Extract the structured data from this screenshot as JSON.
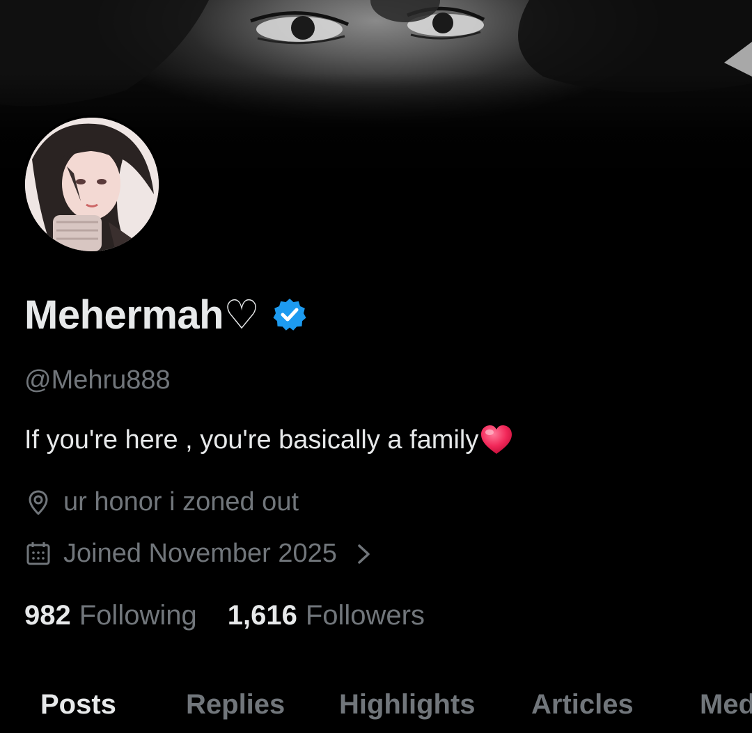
{
  "profile": {
    "display_name": "Mehermah♡",
    "handle": "@Mehru888",
    "bio": "If you're here , you're basically a family",
    "bio_emoji": "red-heart",
    "location": "ur honor i zoned out",
    "joined": "Joined November 2025",
    "verified_color": "#1d9bf0"
  },
  "stats": {
    "following_count": "982",
    "following_label": "Following",
    "followers_count": "1,616",
    "followers_label": "Followers"
  },
  "tabs": {
    "posts": "Posts",
    "replies": "Replies",
    "highlights": "Highlights",
    "articles": "Articles",
    "media": "Media"
  },
  "icons": {
    "location": "location-pin-icon",
    "calendar": "calendar-icon",
    "chevron": "chevron-right-icon",
    "verified": "verified-badge-icon"
  }
}
